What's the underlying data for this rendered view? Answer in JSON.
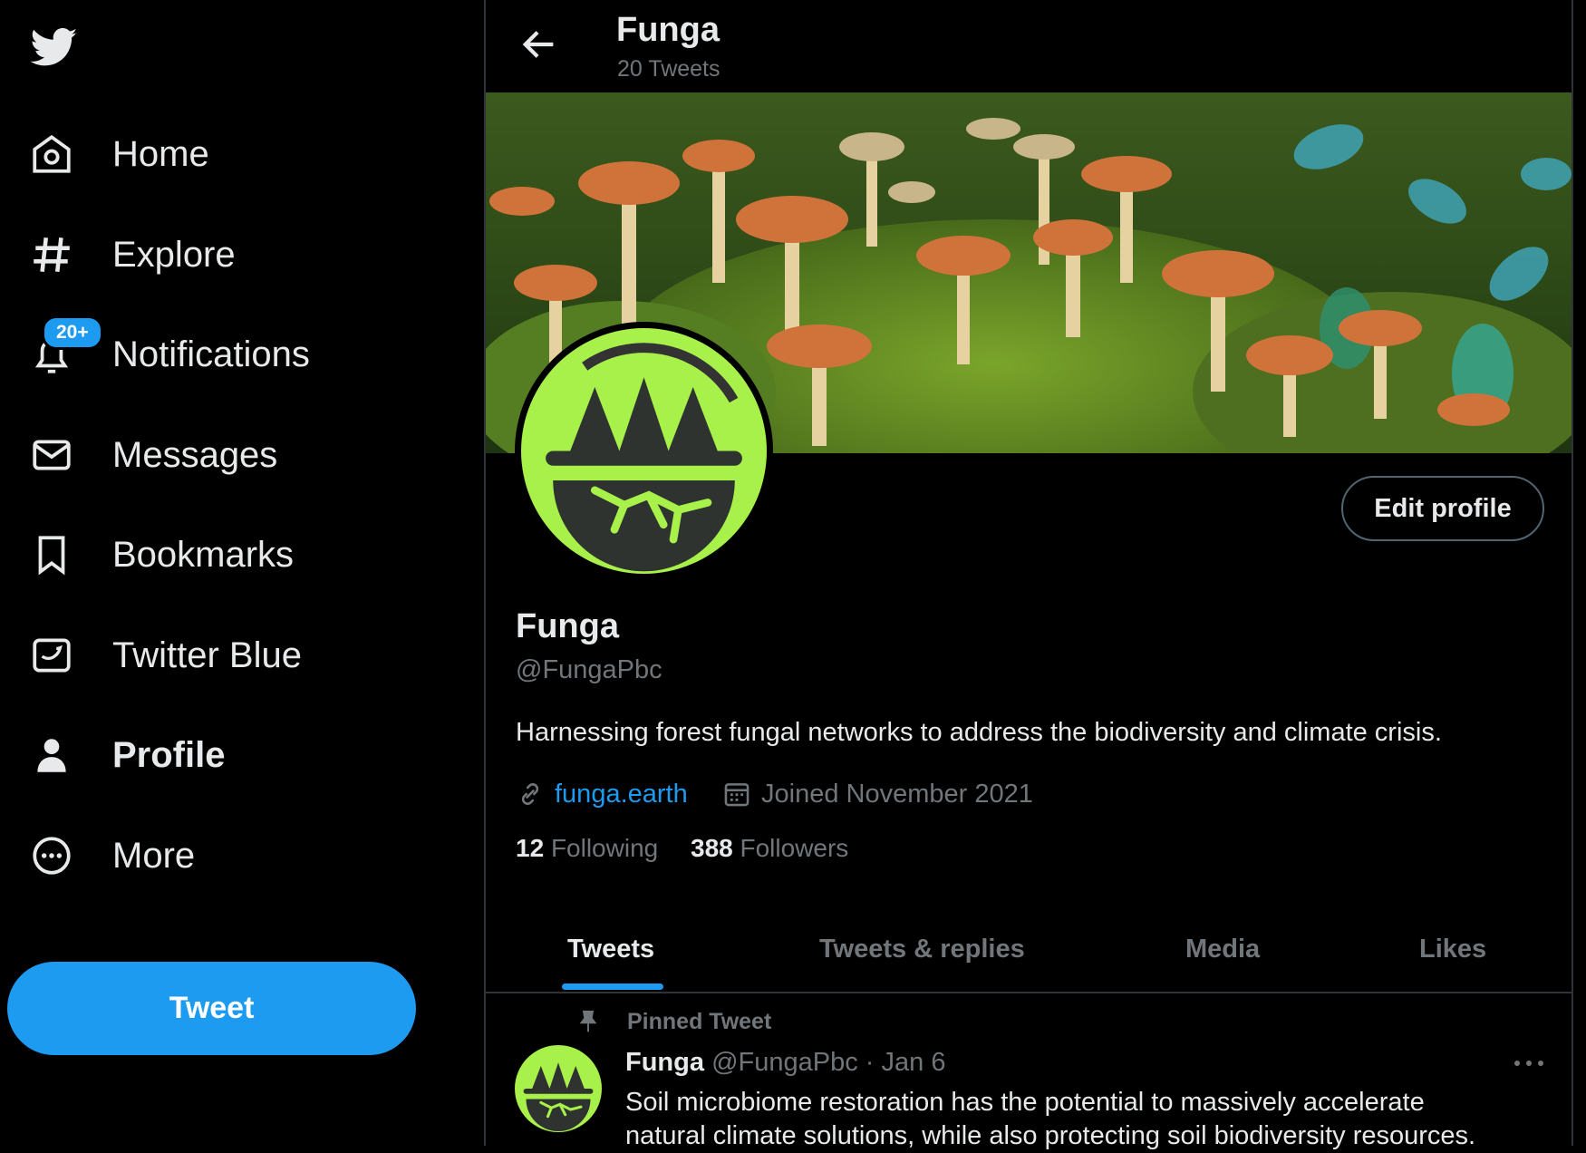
{
  "sidebar": {
    "logo_icon": "twitter-bird-icon",
    "nav": [
      {
        "label": "Home",
        "icon": "home-icon"
      },
      {
        "label": "Explore",
        "icon": "hashtag-icon"
      },
      {
        "label": "Notifications",
        "icon": "bell-icon",
        "badge": "20+"
      },
      {
        "label": "Messages",
        "icon": "envelope-icon"
      },
      {
        "label": "Bookmarks",
        "icon": "bookmark-icon"
      },
      {
        "label": "Twitter Blue",
        "icon": "twitter-blue-icon"
      },
      {
        "label": "Profile",
        "icon": "person-icon",
        "active": true
      },
      {
        "label": "More",
        "icon": "more-circle-icon"
      }
    ],
    "tweet_button": "Tweet"
  },
  "header": {
    "title": "Funga",
    "subtitle": "20 Tweets",
    "back_icon": "arrow-left-icon"
  },
  "profile": {
    "name": "Funga",
    "handle": "@FungaPbc",
    "bio": "Harnessing forest fungal networks to address the biodiversity and climate crisis.",
    "website": "funga.earth",
    "joined": "Joined November 2021",
    "following_count": "12",
    "following_label": "Following",
    "followers_count": "388",
    "followers_label": "Followers",
    "edit_button": "Edit profile"
  },
  "tabs": [
    "Tweets",
    "Tweets & replies",
    "Media",
    "Likes"
  ],
  "active_tab": "Tweets",
  "pinned_tweet": {
    "label": "Pinned Tweet",
    "author": "Funga",
    "handle": "@FungaPbc",
    "separator": "·",
    "date": "Jan 6",
    "text_line1": "Soil microbiome restoration has the potential to massively accelerate",
    "text_line2": "natural climate solutions, while also protecting soil biodiversity resources."
  },
  "colors": {
    "accent": "#1d9bf0",
    "background": "#000000",
    "text": "#e7e9ea",
    "muted": "#71767b",
    "logo_green": "#a8f04a"
  }
}
